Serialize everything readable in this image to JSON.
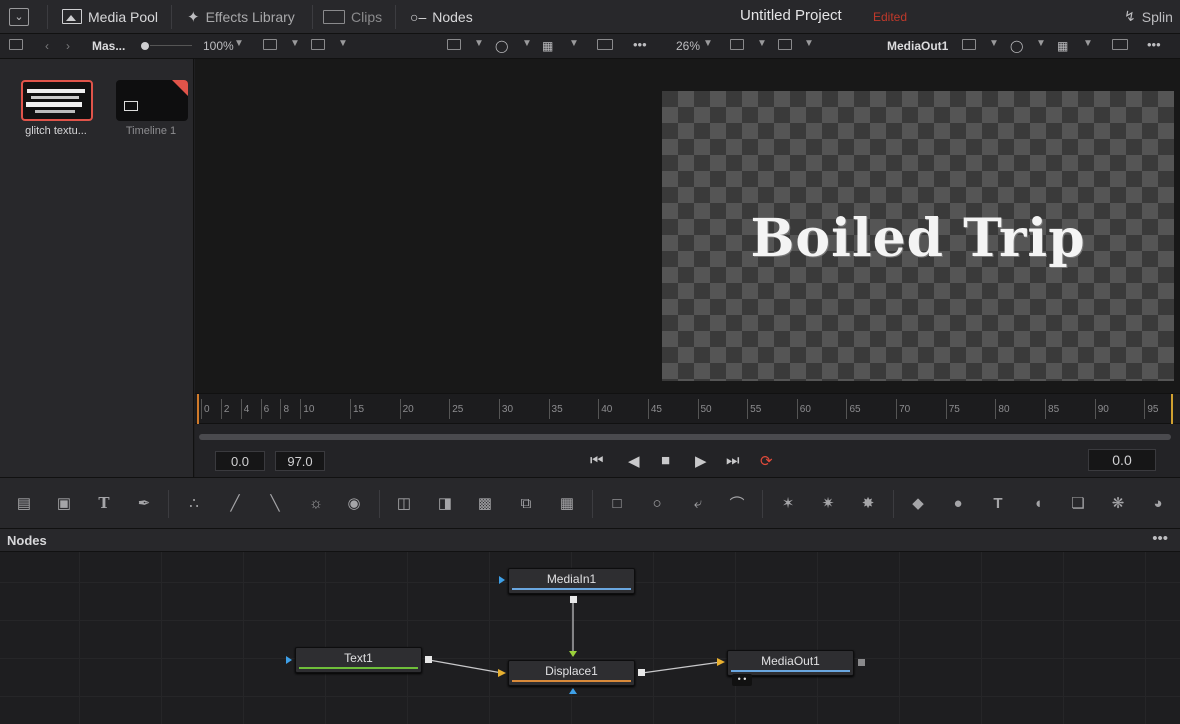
{
  "topbar": {
    "panel_toggle": "panel-toggle",
    "media_pool": "Media Pool",
    "effects_library": "Effects Library",
    "clips": "Clips",
    "nodes": "Nodes",
    "project_title": "Untitled Project",
    "status": "Edited",
    "spline": "Splin"
  },
  "subbar": {
    "bin": "Mas...",
    "zoom_left": "100%",
    "zoom_right": "26%",
    "viewer_node": "MediaOut1"
  },
  "media_pool": {
    "items": [
      {
        "label": "glitch textu...",
        "selected": true
      },
      {
        "label": "Timeline 1",
        "selected": false
      }
    ]
  },
  "viewer": {
    "resolution": "1920x1080xfloat32",
    "rendered_text": "Boiled Trip"
  },
  "timeline": {
    "ticks": [
      "0",
      "2",
      "4",
      "6",
      "8",
      "10",
      "15",
      "20",
      "25",
      "30",
      "35",
      "40",
      "45",
      "50",
      "55",
      "60",
      "65",
      "70",
      "75",
      "80",
      "85",
      "90",
      "95"
    ],
    "start": "0.0",
    "end": "97.0",
    "current": "0.0"
  },
  "nodes_panel": {
    "title": "Nodes",
    "more": "•••",
    "nodes": [
      {
        "id": "mediain1",
        "label": "MediaIn1",
        "bar_color": "#6aa7e0"
      },
      {
        "id": "text1",
        "label": "Text1",
        "bar_color": "#6fbf3a"
      },
      {
        "id": "displace1",
        "label": "Displace1",
        "bar_color": "#d98a3a"
      },
      {
        "id": "mediaout1",
        "label": "MediaOut1",
        "bar_color": "#6aa7e0"
      }
    ]
  },
  "colors": {
    "accent_red": "#c0392b",
    "playhead": "#d07a2a",
    "loop": "#e04a3a"
  }
}
